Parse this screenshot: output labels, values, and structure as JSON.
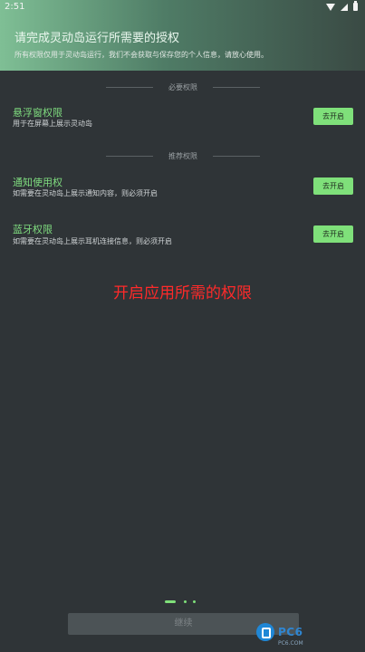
{
  "status_bar": {
    "time": "2:51",
    "icons": [
      "wifi-icon",
      "signal-icon",
      "battery-icon"
    ]
  },
  "header": {
    "title": "请完成灵动岛运行所需要的授权",
    "subtitle": "所有权限仅用于灵动岛运行，我们不会获取与保存您的个人信息，请放心使用。"
  },
  "sections": [
    {
      "label": "必要权限",
      "items": [
        {
          "title": "悬浮窗权限",
          "description": "用于在屏幕上展示灵动岛",
          "button": "去开启"
        }
      ]
    },
    {
      "label": "推荐权限",
      "items": [
        {
          "title": "通知使用权",
          "description": "如需要在灵动岛上展示通知内容，则必须开启",
          "button": "去开启"
        },
        {
          "title": "蓝牙权限",
          "description": "如需要在灵动岛上展示耳机连接信息，则必须开启",
          "button": "去开启"
        }
      ]
    }
  ],
  "overlay_caption": "开启应用所需的权限",
  "pager": {
    "count": 3,
    "active_index": 0
  },
  "footer": {
    "continue_label": "继续"
  },
  "watermark": {
    "text": "PC6",
    "sub": "PC6.COM"
  },
  "colors": {
    "background": "#2f3437",
    "accent_green": "#7fe07a",
    "title_green": "#7fdc7f",
    "caption_red": "#ff2a2a"
  }
}
